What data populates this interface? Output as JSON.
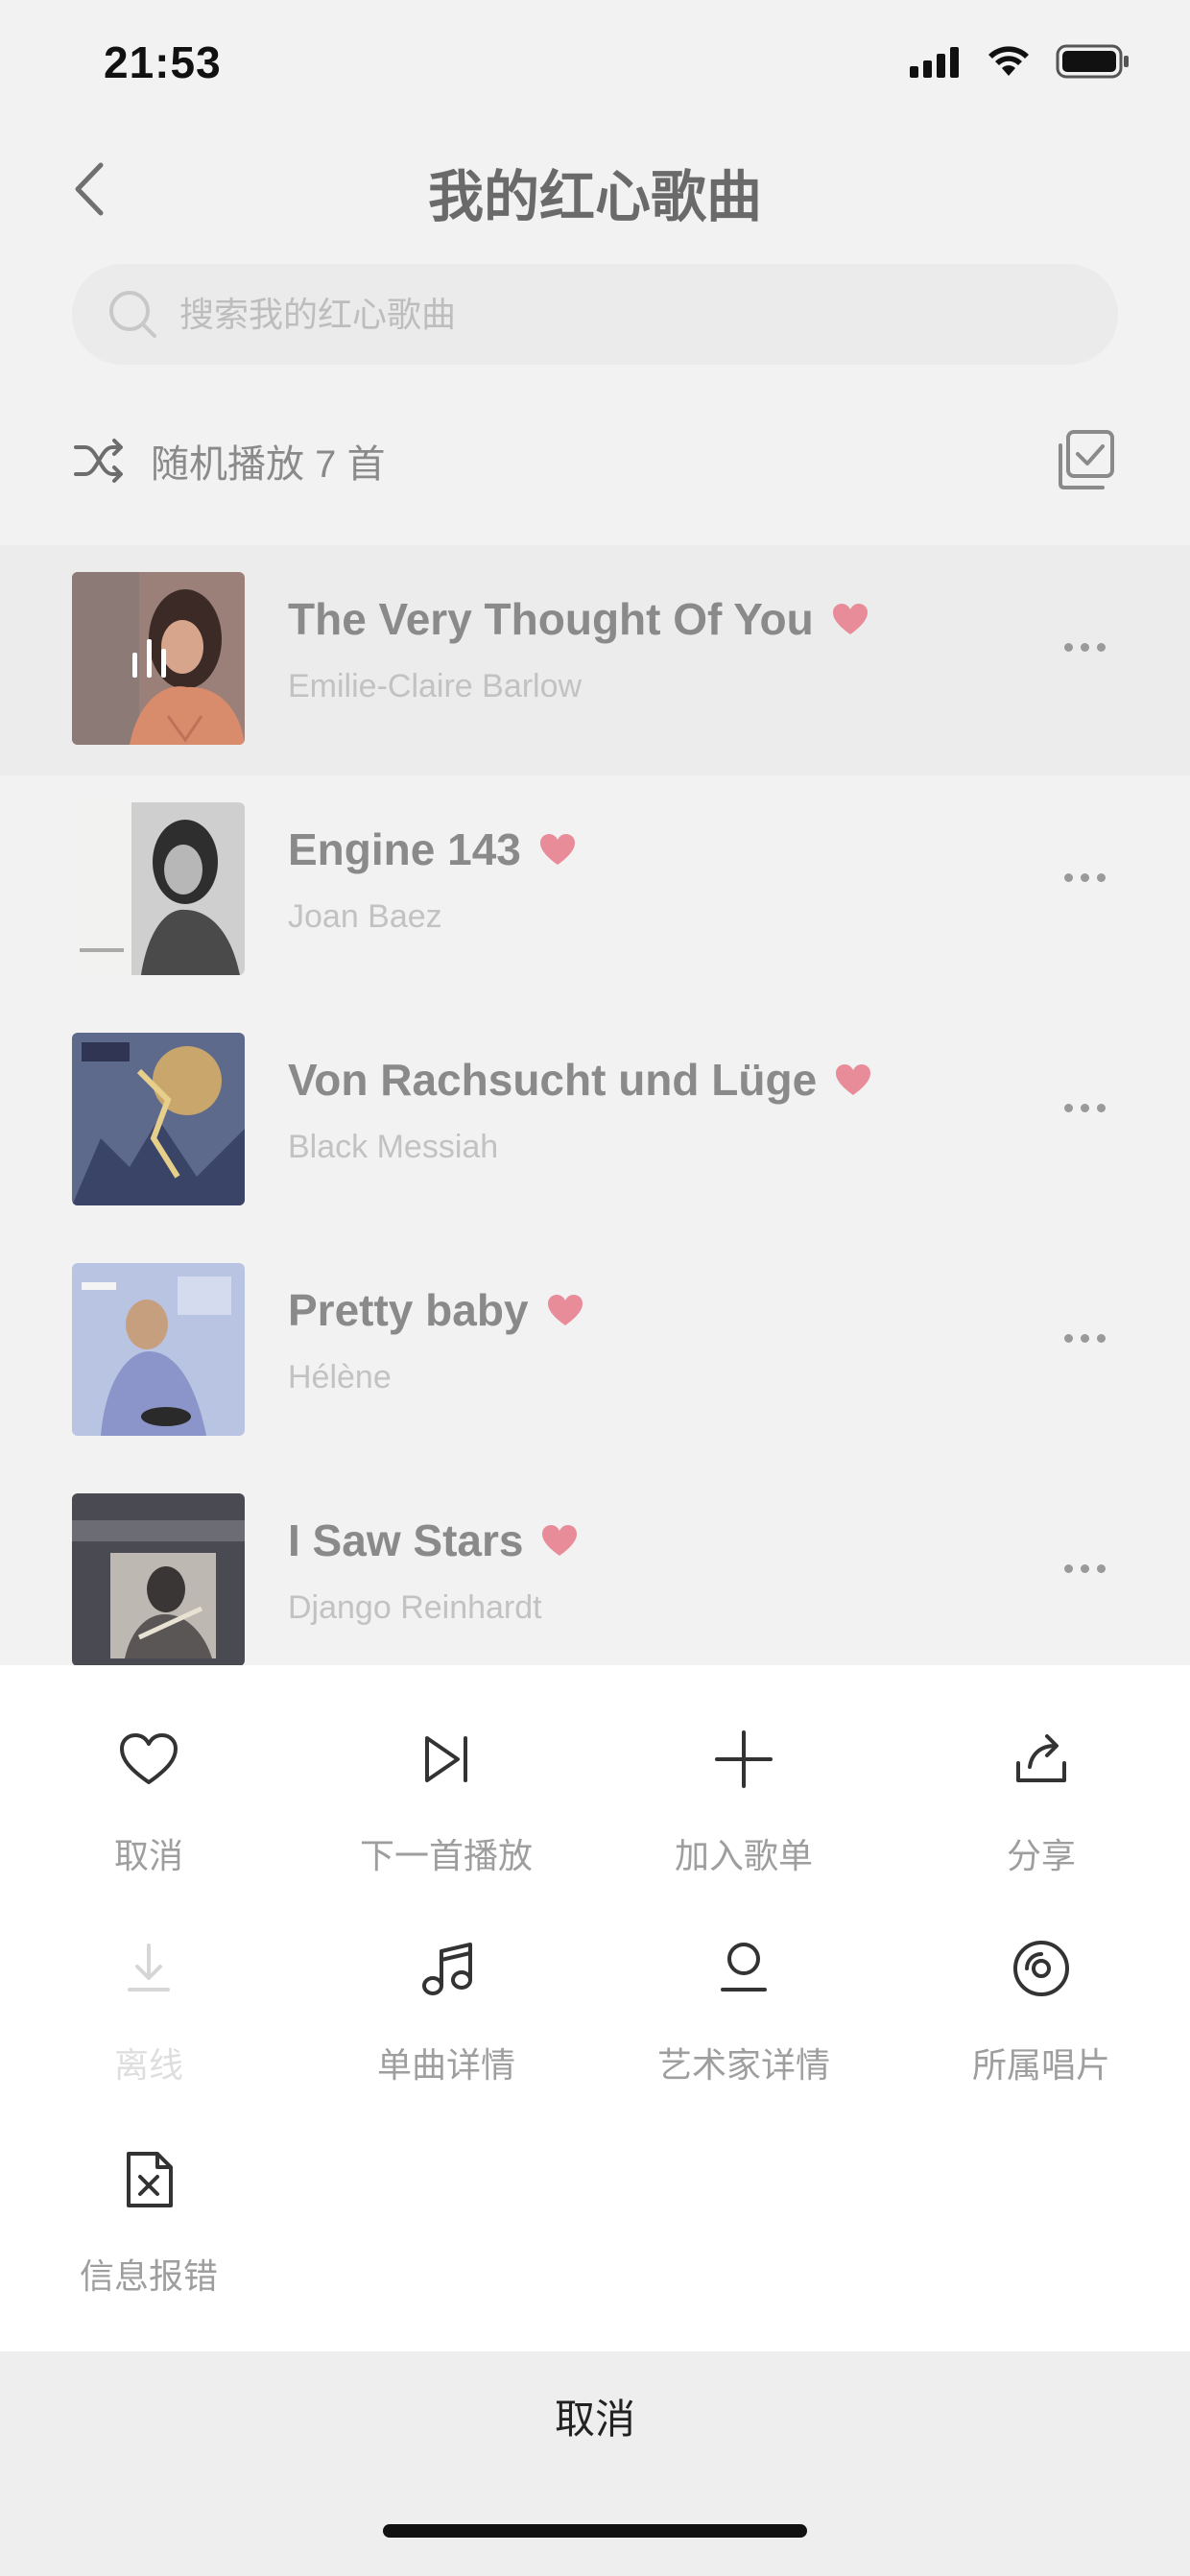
{
  "status_bar": {
    "time": "21:53"
  },
  "nav": {
    "title": "我的红心歌曲"
  },
  "search": {
    "placeholder": "搜索我的红心歌曲"
  },
  "shuffle": {
    "label": "随机播放 7 首"
  },
  "songs": [
    {
      "title": "The Very Thought Of You",
      "artist": "Emilie-Claire Barlow",
      "liked": true,
      "playing": true
    },
    {
      "title": "Engine 143",
      "artist": "Joan Baez",
      "liked": true,
      "playing": false
    },
    {
      "title": "Von Rachsucht und Lüge",
      "artist": "Black Messiah",
      "liked": true,
      "playing": false
    },
    {
      "title": "Pretty baby",
      "artist": "Hélène",
      "liked": true,
      "playing": false
    },
    {
      "title": "I Saw Stars",
      "artist": "Django Reinhardt",
      "liked": true,
      "playing": false
    }
  ],
  "actions": [
    {
      "label": "取消",
      "icon": "heart-outline-icon",
      "enabled": true
    },
    {
      "label": "下一首播放",
      "icon": "play-next-icon",
      "enabled": true
    },
    {
      "label": "加入歌单",
      "icon": "plus-icon",
      "enabled": true
    },
    {
      "label": "分享",
      "icon": "share-icon",
      "enabled": true
    },
    {
      "label": "离线",
      "icon": "download-icon",
      "enabled": false
    },
    {
      "label": "单曲详情",
      "icon": "music-note-icon",
      "enabled": true
    },
    {
      "label": "艺术家详情",
      "icon": "artist-icon",
      "enabled": true
    },
    {
      "label": "所属唱片",
      "icon": "disc-icon",
      "enabled": true
    },
    {
      "label": "信息报错",
      "icon": "report-error-icon",
      "enabled": true
    }
  ],
  "sheet": {
    "cancel_label": "取消"
  },
  "colors": {
    "heart": "#e98c9a",
    "title_gray": "#8a8a8a",
    "artist_gray": "#c2c2c2",
    "icon_dark": "#333333"
  }
}
